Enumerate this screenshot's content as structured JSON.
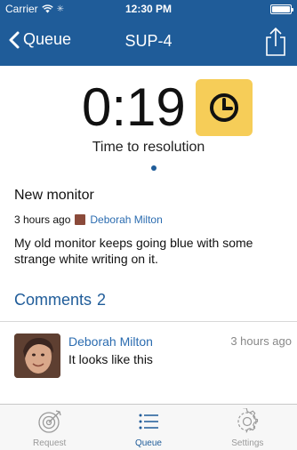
{
  "status_bar": {
    "carrier": "Carrier",
    "time": "12:30 PM",
    "battery_level": 1.0
  },
  "nav": {
    "back_label": "Queue",
    "title": "SUP-4",
    "share_icon": "share-icon"
  },
  "timer": {
    "value": "0:19",
    "label": "Time to resolution",
    "icon": "clock-icon",
    "accent": "#f6cd58"
  },
  "ticket": {
    "title": "New monitor",
    "age": "3 hours ago",
    "author": "Deborah Milton",
    "description": "My old monitor keeps going blue with some strange white writing on it."
  },
  "comments": {
    "header": "Comments",
    "count": "2",
    "items": [
      {
        "author": "Deborah Milton",
        "time": "3 hours ago",
        "text": "It looks like this"
      }
    ]
  },
  "tabs": [
    {
      "label": "Request",
      "icon": "target-icon",
      "active": false
    },
    {
      "label": "Queue",
      "icon": "list-icon",
      "active": true
    },
    {
      "label": "Settings",
      "icon": "gear-icon",
      "active": false
    }
  ],
  "colors": {
    "brand": "#1f5c99",
    "link": "#2b6cb0"
  }
}
